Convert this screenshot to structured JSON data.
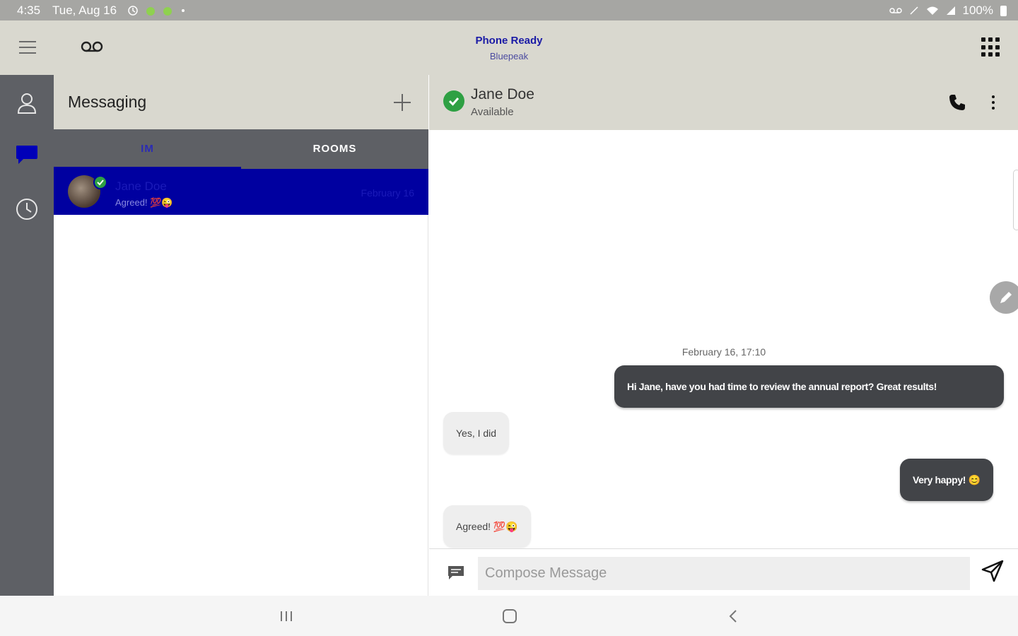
{
  "status_bar": {
    "time": "4:35",
    "date": "Tue, Aug 16",
    "battery": "100%"
  },
  "app_bar": {
    "title": "Phone Ready",
    "subtitle": "Bluepeak"
  },
  "list_pane": {
    "title": "Messaging",
    "tabs": [
      {
        "label": "IM",
        "active": true
      },
      {
        "label": "ROOMS",
        "active": false
      }
    ],
    "conversations": [
      {
        "name": "Jane Doe",
        "preview": "Agreed! 💯😜",
        "date": "February 16"
      }
    ]
  },
  "chat": {
    "contact_name": "Jane Doe",
    "contact_status": "Available",
    "date_separator": "February 16, 17:10",
    "messages": [
      {
        "direction": "out",
        "text": "Hi Jane, have you had time to review the annual report? Great results!"
      },
      {
        "direction": "in",
        "text": "Yes, I did"
      },
      {
        "direction": "out",
        "text": "Very happy! 😊"
      },
      {
        "direction": "in",
        "text": "Agreed! 💯😜"
      }
    ],
    "composer_placeholder": "Compose Message"
  },
  "colors": {
    "accent": "#0000a0",
    "rail": "#5e6065",
    "header": "#d9d8cf",
    "outgoing_bubble": "#424448",
    "online": "#2ea043"
  }
}
